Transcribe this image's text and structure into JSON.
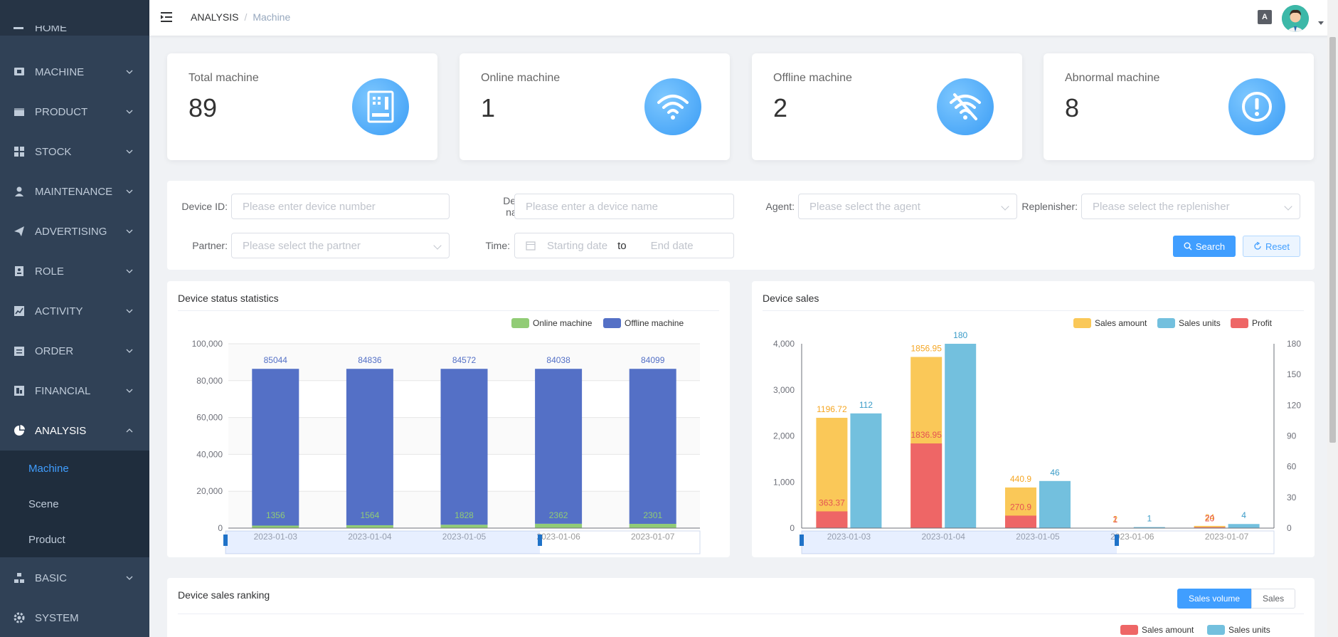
{
  "sidebar": {
    "items": [
      {
        "label": "HOME",
        "icon": "home-icon"
      },
      {
        "label": "MACHINE",
        "icon": "machine-icon"
      },
      {
        "label": "PRODUCT",
        "icon": "product-icon"
      },
      {
        "label": "STOCK",
        "icon": "stock-icon"
      },
      {
        "label": "MAINTENANCE",
        "icon": "maintenance-icon"
      },
      {
        "label": "ADVERTISING",
        "icon": "advertising-icon"
      },
      {
        "label": "ROLE",
        "icon": "role-icon"
      },
      {
        "label": "ACTIVITY",
        "icon": "activity-icon"
      },
      {
        "label": "ORDER",
        "icon": "order-icon"
      },
      {
        "label": "FINANCIAL",
        "icon": "financial-icon"
      },
      {
        "label": "ANALYSIS",
        "icon": "analysis-icon"
      },
      {
        "label": "BASIC",
        "icon": "basic-icon"
      },
      {
        "label": "SYSTEM",
        "icon": "system-icon"
      }
    ],
    "analysis_sub": [
      {
        "label": "Machine",
        "active": true
      },
      {
        "label": "Scene",
        "active": false
      },
      {
        "label": "Product",
        "active": false
      }
    ]
  },
  "header": {
    "breadcrumb": [
      "ANALYSIS",
      "Machine"
    ],
    "lang_icon_text": "A"
  },
  "cards": [
    {
      "title": "Total machine",
      "value": "89",
      "icon": "cabinet-icon"
    },
    {
      "title": "Online machine",
      "value": "1",
      "icon": "wifi-icon"
    },
    {
      "title": "Offline machine",
      "value": "2",
      "icon": "wifi-off-icon"
    },
    {
      "title": "Abnormal machine",
      "value": "8",
      "icon": "alert-icon"
    }
  ],
  "filter": {
    "device_id_label": "Device ID:",
    "device_id_placeholder": "Please enter device number",
    "device_name_label_1": "Device",
    "device_name_label_2": "name:",
    "device_name_placeholder": "Please enter a device name",
    "agent_label": "Agent:",
    "agent_placeholder": "Please select the agent",
    "replenisher_label": "Replenisher:",
    "replenisher_placeholder": "Please select the replenisher",
    "partner_label": "Partner:",
    "partner_placeholder": "Please select the partner",
    "time_label": "Time:",
    "start_placeholder": "Starting date",
    "range_sep": "to",
    "end_placeholder": "End date",
    "search_btn": "Search",
    "reset_btn": "Reset"
  },
  "status_panel": {
    "title": "Device status statistics"
  },
  "sales_panel": {
    "title": "Device sales"
  },
  "ranking_panel": {
    "title": "Device sales ranking",
    "toggle": [
      "Sales volume",
      "Sales"
    ],
    "legend": [
      "Sales amount",
      "Sales units"
    ]
  },
  "colors": {
    "online": "#91cc75",
    "offline": "#5470c6",
    "sales_amount": "#fac858",
    "sales_units": "#73c0de",
    "profit": "#ee6666",
    "accent": "#409eff"
  },
  "chart_data": [
    {
      "type": "bar",
      "stacked": true,
      "categories": [
        "2023-01-03",
        "2023-01-04",
        "2023-01-05",
        "2023-01-06",
        "2023-01-07"
      ],
      "series": [
        {
          "name": "Online machine",
          "values": [
            1356,
            1564,
            1828,
            2362,
            2301
          ]
        },
        {
          "name": "Offline machine",
          "values": [
            85044,
            84836,
            84572,
            84038,
            84099
          ]
        }
      ],
      "yticks": [
        "0",
        "20,000",
        "40,000",
        "60,000",
        "80,000",
        "100,000"
      ],
      "ylim": [
        0,
        100000
      ],
      "legend": "top-right"
    },
    {
      "type": "bar",
      "categories": [
        "2023-01-03",
        "2023-01-04",
        "2023-01-05",
        "2023-01-06",
        "2023-01-07"
      ],
      "series": [
        {
          "name": "Sales amount",
          "axis": "left",
          "values": [
            1196.72,
            1856.95,
            440.9,
            2,
            24
          ],
          "labels": [
            "1196.72",
            "1856.95",
            "440.9",
            "2",
            "24"
          ]
        },
        {
          "name": "Sales units",
          "axis": "right",
          "values": [
            112,
            180,
            46,
            1,
            4
          ],
          "labels": [
            "112",
            "180",
            "46",
            "1",
            "4"
          ]
        },
        {
          "name": "Profit",
          "axis": "left",
          "values": [
            363.37,
            1836.95,
            270.9,
            1,
            20
          ],
          "labels": [
            "363.37",
            "1836.95",
            "270.9",
            "1",
            "20"
          ]
        }
      ],
      "yticks_left": [
        "0",
        "1,000",
        "2,000",
        "3,000",
        "4,000"
      ],
      "yticks_right": [
        "0",
        "30",
        "60",
        "90",
        "120",
        "150",
        "180"
      ],
      "ylim_left": [
        0,
        4000
      ],
      "ylim_right": [
        0,
        180
      ],
      "legend": "top-right"
    }
  ]
}
